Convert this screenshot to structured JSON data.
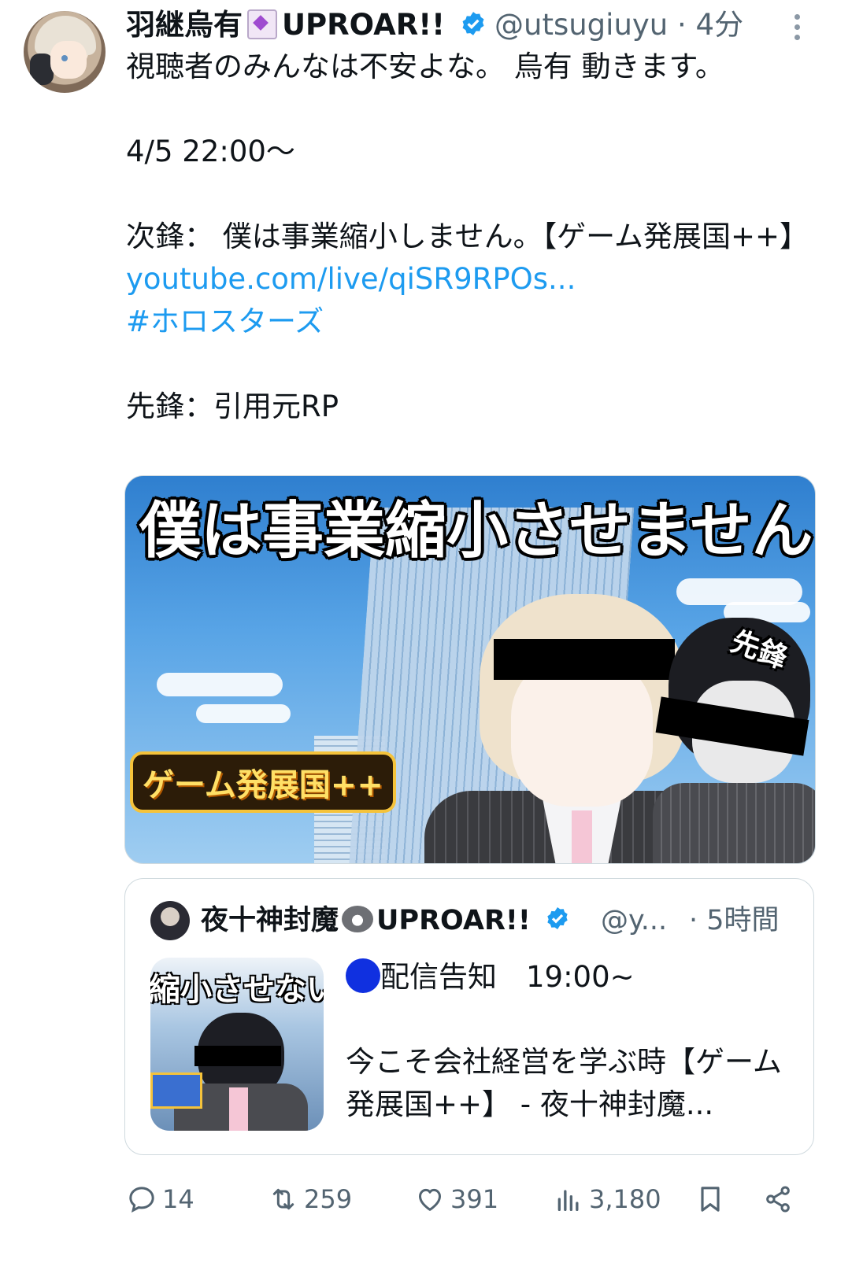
{
  "author": {
    "display_name": "羽継烏有",
    "affiliation": "UPROAR!!",
    "handle_time": "@utsugiuyu · 4分"
  },
  "tweet": {
    "lines": [
      "視聴者のみんなは不安よな。 烏有 動きます。",
      "4/5 22:00〜",
      "次鋒： 僕は事業縮小しません。【ゲーム発展国++】",
      "先鋒：引用元RP"
    ],
    "link": "youtube.com/live/qiSR9RPOs...",
    "hashtag": "#ホロスターズ"
  },
  "media": {
    "title": "僕は事業縮小させません",
    "corner_label": "先鋒",
    "logo": "ゲーム発展国++"
  },
  "quote": {
    "display_name": "夜十神封魔",
    "affiliation": "UPROAR!!",
    "handle": "@y...",
    "time": "· 5時間",
    "thumb_title": "縮小させない会社",
    "line1": "配信告知　19:00~",
    "line2": "今こそ会社経営を学ぶ時【ゲーム発展国++】 - 夜十神封魔..."
  },
  "actions": {
    "replies": "14",
    "reposts": "259",
    "likes": "391",
    "views": "3,180"
  },
  "colors": {
    "link": "#1d9bf0",
    "verified": "#1d9bf0",
    "secondary_text": "#536471"
  }
}
